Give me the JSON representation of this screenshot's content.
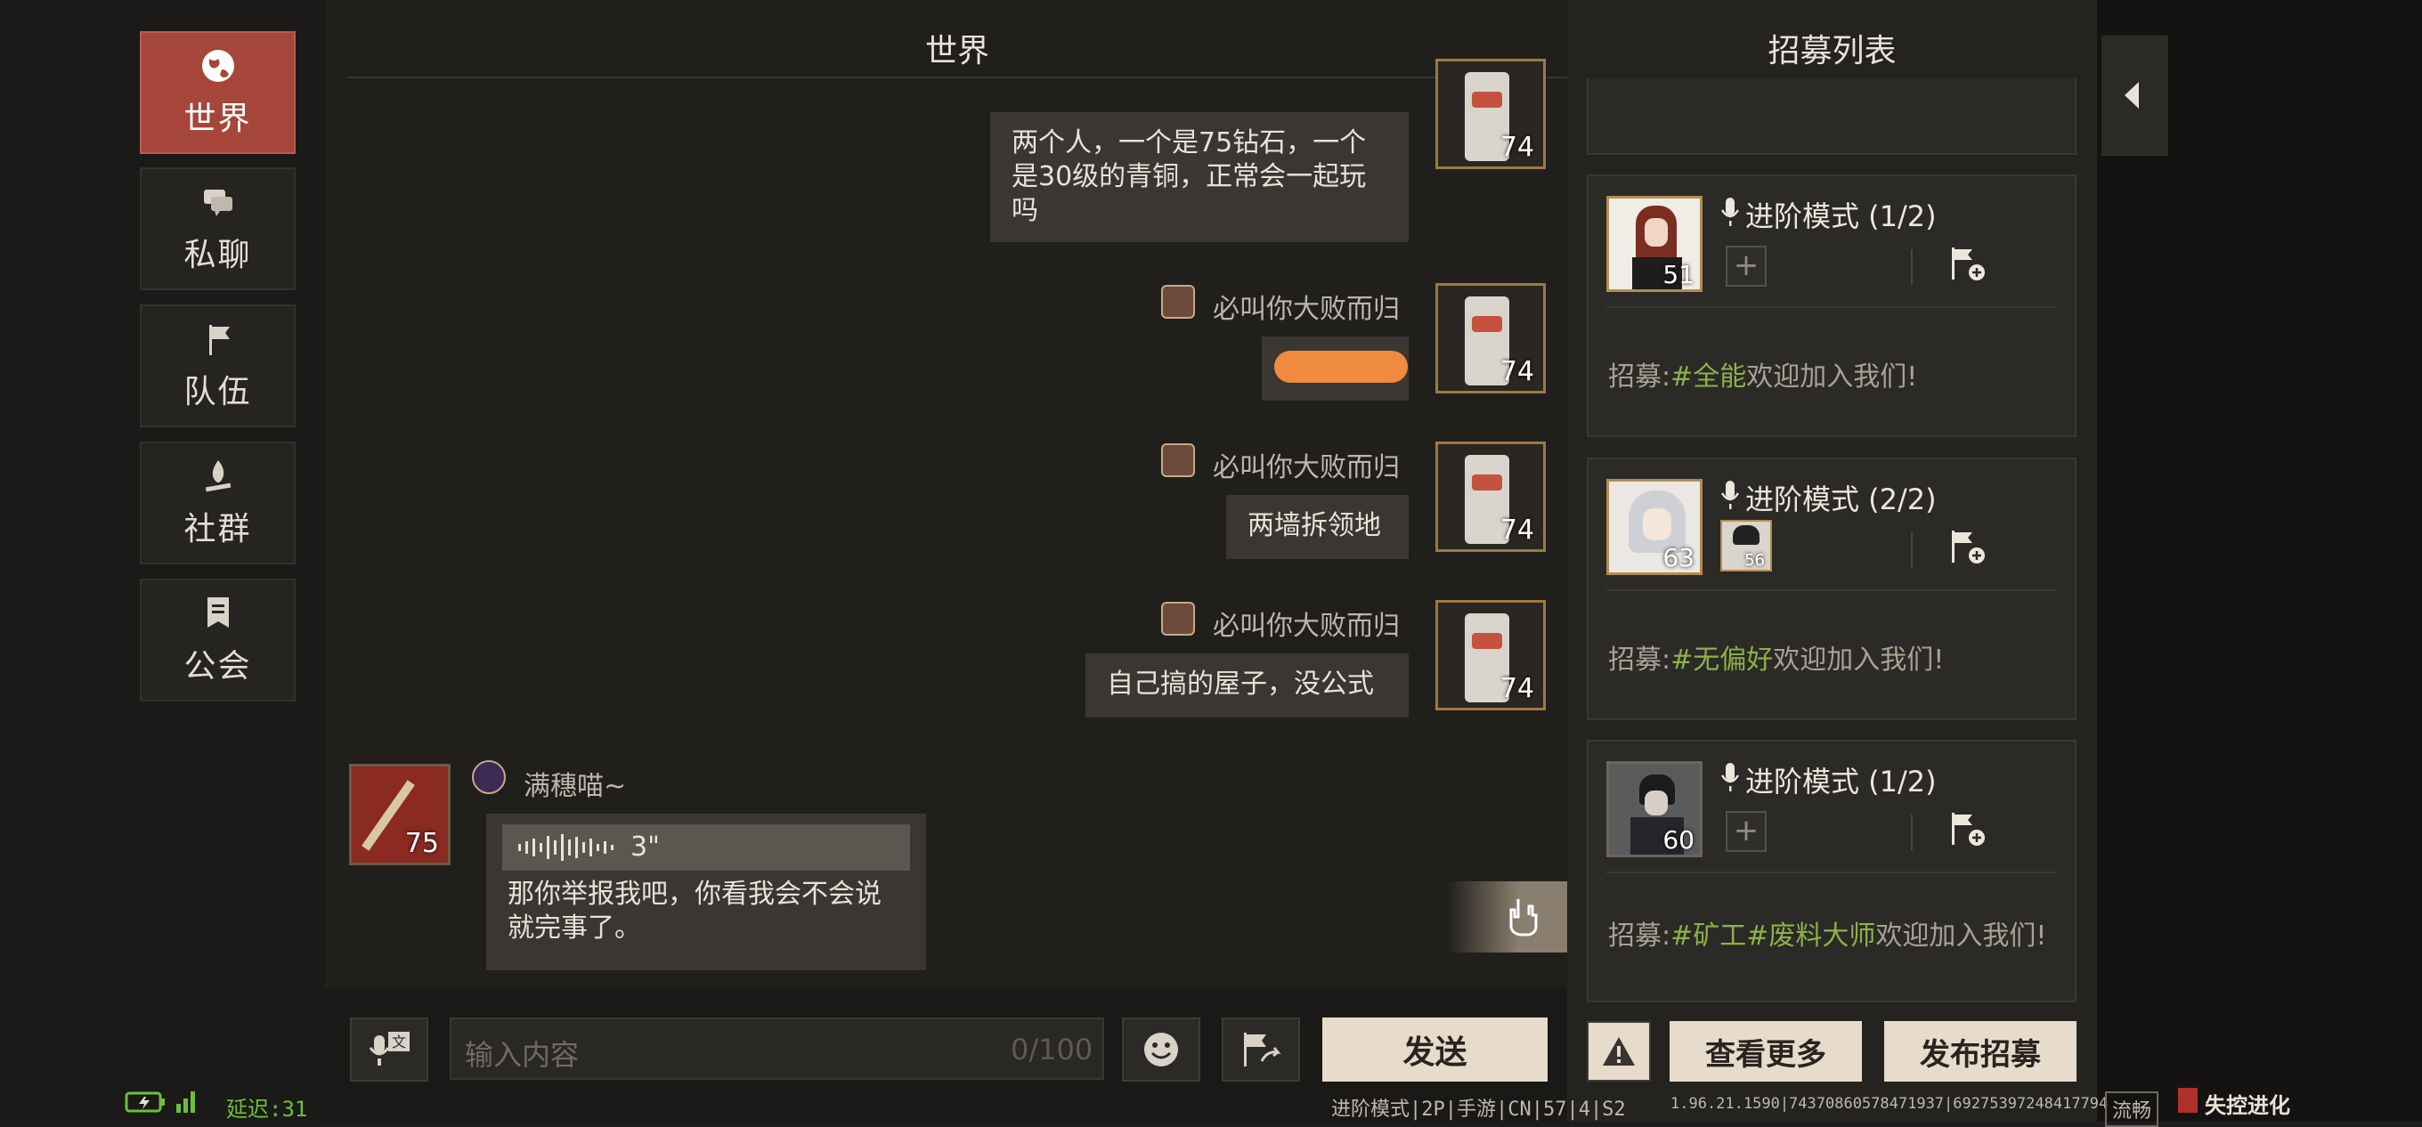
{
  "sidebar": {
    "items": [
      {
        "label": "世界",
        "icon": "globe-icon",
        "active": true
      },
      {
        "label": "私聊",
        "icon": "chat-bubbles-icon",
        "active": false
      },
      {
        "label": "队伍",
        "icon": "flag-icon",
        "active": false
      },
      {
        "label": "社群",
        "icon": "campfire-icon",
        "active": false
      },
      {
        "label": "公会",
        "icon": "banner-icon",
        "active": false
      }
    ]
  },
  "chat": {
    "title": "世界",
    "messages": [
      {
        "sender": "必叫你大败而归",
        "text": "两个人，一个是75钻石，一个是30级的青铜，正常会一起玩吗",
        "level": "74"
      },
      {
        "sender": "必叫你大败而归",
        "text": "",
        "level": "74"
      },
      {
        "sender": "必叫你大败而归",
        "text": "两墙拆领地",
        "level": "74"
      },
      {
        "sender": "必叫你大败而归",
        "text": "自己搞的屋子，没公式",
        "level": "74"
      },
      {
        "sender": "满穗喵~",
        "voice_duration": "3\"",
        "text": "那你举报我吧，你看我会不会说就完事了。",
        "level": "75"
      }
    ]
  },
  "input": {
    "placeholder": "输入内容",
    "counter": "0/100",
    "send_label": "发送"
  },
  "recruit": {
    "title": "招募列表",
    "cards": [
      {
        "mode": "进阶模式 (1/2)",
        "level": "51",
        "prefix": "招募:",
        "tags": "#全能",
        "suffix": "欢迎加入我们!"
      },
      {
        "mode": "进阶模式 (2/2)",
        "level": "63",
        "level2": "56",
        "prefix": "招募:",
        "tags": "#无偏好",
        "suffix": "欢迎加入我们!"
      },
      {
        "mode": "进阶模式 (1/2)",
        "level": "60",
        "prefix": "招募:",
        "tags": "#矿工#废料大师",
        "suffix": "欢迎加入我们!"
      }
    ],
    "view_more_label": "查看更多",
    "publish_label": "发布招募"
  },
  "status": {
    "latency": "延迟:31",
    "mode_info": "进阶模式|2P|手游|CN|57|4|S2",
    "build_info": "1.96.21.1590|74370860578471937|69275397248417794",
    "network": "流畅",
    "logo_text": "失控进化"
  },
  "colors": {
    "active_tab": "#a6463a",
    "tag_green": "#8fb04a",
    "latency_green": "#6fbe3a",
    "bubble_bg": "#3a3733"
  }
}
